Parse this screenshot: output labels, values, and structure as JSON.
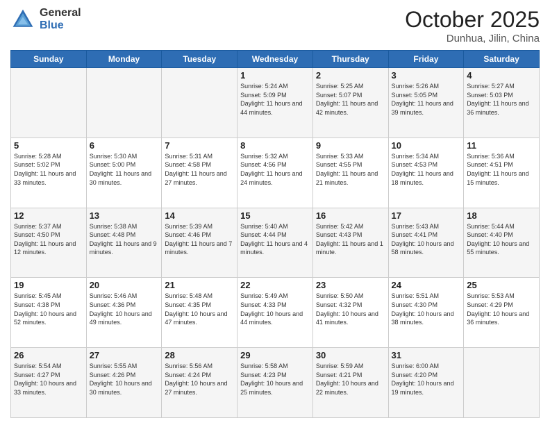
{
  "header": {
    "logo_general": "General",
    "logo_blue": "Blue",
    "month": "October 2025",
    "location": "Dunhua, Jilin, China"
  },
  "weekdays": [
    "Sunday",
    "Monday",
    "Tuesday",
    "Wednesday",
    "Thursday",
    "Friday",
    "Saturday"
  ],
  "weeks": [
    [
      {
        "day": "",
        "info": ""
      },
      {
        "day": "",
        "info": ""
      },
      {
        "day": "",
        "info": ""
      },
      {
        "day": "1",
        "info": "Sunrise: 5:24 AM\nSunset: 5:09 PM\nDaylight: 11 hours and 44 minutes."
      },
      {
        "day": "2",
        "info": "Sunrise: 5:25 AM\nSunset: 5:07 PM\nDaylight: 11 hours and 42 minutes."
      },
      {
        "day": "3",
        "info": "Sunrise: 5:26 AM\nSunset: 5:05 PM\nDaylight: 11 hours and 39 minutes."
      },
      {
        "day": "4",
        "info": "Sunrise: 5:27 AM\nSunset: 5:03 PM\nDaylight: 11 hours and 36 minutes."
      }
    ],
    [
      {
        "day": "5",
        "info": "Sunrise: 5:28 AM\nSunset: 5:02 PM\nDaylight: 11 hours and 33 minutes."
      },
      {
        "day": "6",
        "info": "Sunrise: 5:30 AM\nSunset: 5:00 PM\nDaylight: 11 hours and 30 minutes."
      },
      {
        "day": "7",
        "info": "Sunrise: 5:31 AM\nSunset: 4:58 PM\nDaylight: 11 hours and 27 minutes."
      },
      {
        "day": "8",
        "info": "Sunrise: 5:32 AM\nSunset: 4:56 PM\nDaylight: 11 hours and 24 minutes."
      },
      {
        "day": "9",
        "info": "Sunrise: 5:33 AM\nSunset: 4:55 PM\nDaylight: 11 hours and 21 minutes."
      },
      {
        "day": "10",
        "info": "Sunrise: 5:34 AM\nSunset: 4:53 PM\nDaylight: 11 hours and 18 minutes."
      },
      {
        "day": "11",
        "info": "Sunrise: 5:36 AM\nSunset: 4:51 PM\nDaylight: 11 hours and 15 minutes."
      }
    ],
    [
      {
        "day": "12",
        "info": "Sunrise: 5:37 AM\nSunset: 4:50 PM\nDaylight: 11 hours and 12 minutes."
      },
      {
        "day": "13",
        "info": "Sunrise: 5:38 AM\nSunset: 4:48 PM\nDaylight: 11 hours and 9 minutes."
      },
      {
        "day": "14",
        "info": "Sunrise: 5:39 AM\nSunset: 4:46 PM\nDaylight: 11 hours and 7 minutes."
      },
      {
        "day": "15",
        "info": "Sunrise: 5:40 AM\nSunset: 4:44 PM\nDaylight: 11 hours and 4 minutes."
      },
      {
        "day": "16",
        "info": "Sunrise: 5:42 AM\nSunset: 4:43 PM\nDaylight: 11 hours and 1 minute."
      },
      {
        "day": "17",
        "info": "Sunrise: 5:43 AM\nSunset: 4:41 PM\nDaylight: 10 hours and 58 minutes."
      },
      {
        "day": "18",
        "info": "Sunrise: 5:44 AM\nSunset: 4:40 PM\nDaylight: 10 hours and 55 minutes."
      }
    ],
    [
      {
        "day": "19",
        "info": "Sunrise: 5:45 AM\nSunset: 4:38 PM\nDaylight: 10 hours and 52 minutes."
      },
      {
        "day": "20",
        "info": "Sunrise: 5:46 AM\nSunset: 4:36 PM\nDaylight: 10 hours and 49 minutes."
      },
      {
        "day": "21",
        "info": "Sunrise: 5:48 AM\nSunset: 4:35 PM\nDaylight: 10 hours and 47 minutes."
      },
      {
        "day": "22",
        "info": "Sunrise: 5:49 AM\nSunset: 4:33 PM\nDaylight: 10 hours and 44 minutes."
      },
      {
        "day": "23",
        "info": "Sunrise: 5:50 AM\nSunset: 4:32 PM\nDaylight: 10 hours and 41 minutes."
      },
      {
        "day": "24",
        "info": "Sunrise: 5:51 AM\nSunset: 4:30 PM\nDaylight: 10 hours and 38 minutes."
      },
      {
        "day": "25",
        "info": "Sunrise: 5:53 AM\nSunset: 4:29 PM\nDaylight: 10 hours and 36 minutes."
      }
    ],
    [
      {
        "day": "26",
        "info": "Sunrise: 5:54 AM\nSunset: 4:27 PM\nDaylight: 10 hours and 33 minutes."
      },
      {
        "day": "27",
        "info": "Sunrise: 5:55 AM\nSunset: 4:26 PM\nDaylight: 10 hours and 30 minutes."
      },
      {
        "day": "28",
        "info": "Sunrise: 5:56 AM\nSunset: 4:24 PM\nDaylight: 10 hours and 27 minutes."
      },
      {
        "day": "29",
        "info": "Sunrise: 5:58 AM\nSunset: 4:23 PM\nDaylight: 10 hours and 25 minutes."
      },
      {
        "day": "30",
        "info": "Sunrise: 5:59 AM\nSunset: 4:21 PM\nDaylight: 10 hours and 22 minutes."
      },
      {
        "day": "31",
        "info": "Sunrise: 6:00 AM\nSunset: 4:20 PM\nDaylight: 10 hours and 19 minutes."
      },
      {
        "day": "",
        "info": ""
      }
    ]
  ]
}
